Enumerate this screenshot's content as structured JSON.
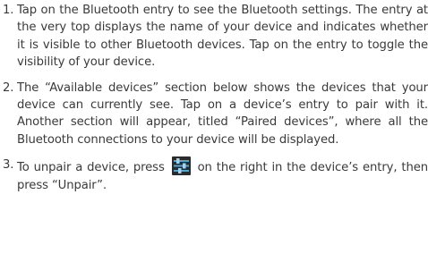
{
  "steps": [
    {
      "number": "1.",
      "text": "Tap on the Bluetooth entry to see the Bluetooth settings. The entry at the very top displays the name of your device and indicates whether it is visible to other Bluetooth devices. Tap on the entry to toggle the visibility of your device."
    },
    {
      "number": "2.",
      "text": "The “Available devices” section below shows the devices that your device can currently see. Tap on a device’s entry to pair with it. Another section will appear, titled “Paired devices”, where all the Bluetooth connections to your device will be displayed."
    },
    {
      "number": "3.",
      "text_before": "To unpair a device, press",
      "icon": "settings-sliders-icon",
      "text_after": "on the right in the device’s entry, then press “Unpair”."
    }
  ],
  "colors": {
    "text": "#3a3a3a",
    "icon_background": "#2b2b2b",
    "icon_bars": "#4aa8d8"
  }
}
